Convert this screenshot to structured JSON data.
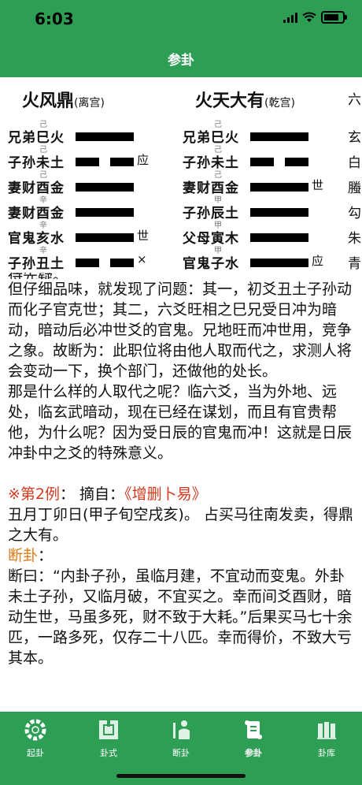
{
  "status": {
    "time": "6:03"
  },
  "nav": {
    "title": "参卦"
  },
  "hexagrams": [
    {
      "name": "火风鼎",
      "palace": "(离宫)",
      "lines": [
        {
          "relation": "兄弟巳火",
          "anno": "己",
          "type": "yang",
          "mark": ""
        },
        {
          "relation": "子孙未土",
          "anno": "己",
          "type": "yin",
          "mark": "应"
        },
        {
          "relation": "妻财酉金",
          "anno": "己",
          "type": "yang",
          "mark": ""
        },
        {
          "relation": "妻财酉金",
          "anno": "辛",
          "type": "yang",
          "mark": ""
        },
        {
          "relation": "官鬼亥水",
          "anno": "辛",
          "type": "yang",
          "mark": "世"
        },
        {
          "relation": "子孙丑土",
          "anno": "辛",
          "type": "yin",
          "mark": "×"
        }
      ]
    },
    {
      "name": "火天大有",
      "palace": "(乾宫)",
      "lines": [
        {
          "relation": "兄弟巳火",
          "anno": "己",
          "type": "yang",
          "mark": ""
        },
        {
          "relation": "子孙未土",
          "anno": "己",
          "type": "yin",
          "mark": ""
        },
        {
          "relation": "妻财酉金",
          "anno": "己",
          "type": "yang",
          "mark": "世"
        },
        {
          "relation": "子孙辰土",
          "anno": "甲",
          "type": "yang",
          "mark": ""
        },
        {
          "relation": "父母寅木",
          "anno": "甲",
          "type": "yang",
          "mark": ""
        },
        {
          "relation": "官鬼子水",
          "anno": "甲",
          "type": "yang",
          "mark": "应"
        }
      ]
    }
  ],
  "third_column": {
    "title": "六",
    "items": [
      "玄",
      "白",
      "螣",
      "勾",
      "朱",
      "青"
    ]
  },
  "content": {
    "cut_line": "待先疑。",
    "para1": "但仔细品味，就发现了问题：其一，初爻丑土子孙动而化子官克世；其二，六爻旺相之巳兄受日冲为暗动，暗动后必冲世爻的官鬼。兄地旺而冲世用，竞争之象。故断为：此职位将由他人取而代之，求测人将会变动一下，换个部门，还做他的处长。",
    "para2": "那是什么样的人取代之呢？临六爻，当为外地、远处，临玄武暗动，现在已经在谋划，而且有官贵帮他，为什么呢？因为受日辰的官鬼而冲！这就是日辰冲卦中之爻的特殊意义。",
    "example_label": "※第2例",
    "example_colon": "：  摘自：",
    "example_source": "《增删卜易》",
    "date_line": "丑月丁卯日(甲子旬空戌亥)。 占买马往南发卖，得鼎之大有。",
    "judge_label": "断卦",
    "judge_colon": "：",
    "para3": "断曰：“内卦子孙，虽临月建，不宜动而变鬼。外卦未土子孙，又临月破，不宜买之。幸而间爻酉财，暗动生世，马虽多死，财不致于大耗。”后果买马七十余匹，一路多死，仅存二十八匹。幸而得价，不致大亏其本。"
  },
  "tabs": [
    {
      "label": "起卦",
      "icon": "gear-ring-icon"
    },
    {
      "label": "卦式",
      "icon": "hexagram-frame-icon"
    },
    {
      "label": "断卦",
      "icon": "pen-person-icon"
    },
    {
      "label": "参卦",
      "icon": "scroll-icon"
    },
    {
      "label": "卦库",
      "icon": "library-icon"
    }
  ],
  "colors": {
    "header_green": "#2e9e55",
    "highlight_red": "#d23a1e",
    "highlight_orange": "#e07b1a"
  }
}
